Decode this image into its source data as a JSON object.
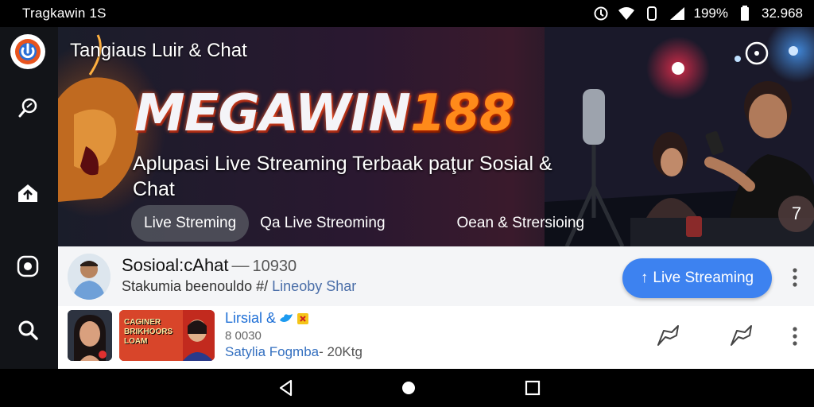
{
  "status_bar": {
    "left_text": "Tragkawin 1S",
    "battery": "199%",
    "time": "32.968"
  },
  "nav_rail": {
    "items": [
      {
        "name": "app-logo",
        "icon": "megawin-logo"
      },
      {
        "name": "nav-explore",
        "icon": "compass-icon"
      },
      {
        "name": "nav-home",
        "icon": "home-upload-icon"
      },
      {
        "name": "nav-live",
        "icon": "record-icon"
      },
      {
        "name": "nav-search",
        "icon": "search-icon"
      }
    ]
  },
  "hero": {
    "title": "Tangiaus Luir & Chat",
    "brand_part1": "MEGAWIN",
    "brand_part2": "188",
    "subtitle": "Aplupasi Live Streaming Terbaak paţur Sosial & Chat",
    "tabs": [
      {
        "label": "Live Streming",
        "active": true
      },
      {
        "label": "Qa Live Streoming",
        "active": false
      },
      {
        "label": "Oean & Strersioing",
        "active": false
      }
    ],
    "fab_label": "7",
    "accent_color": "#ff8a1a"
  },
  "row1": {
    "title": "Sosioal:cAhat",
    "dash": "—",
    "count": "10930",
    "subtitle_prefix": "Stakumia beenouldo #/",
    "subtitle_handle": "Lineoby Shar",
    "button_label": "Live Streaming",
    "button_prefix": "↑",
    "button_color": "#3d82f0"
  },
  "row2": {
    "thumb2_text": "CAGINER BRIKHOORS LOAM",
    "title": "Lirsial &",
    "count": "8 0030",
    "subtitle_loc": "Satylia Fogmba",
    "subtitle_rest": "- 20Ktg"
  }
}
